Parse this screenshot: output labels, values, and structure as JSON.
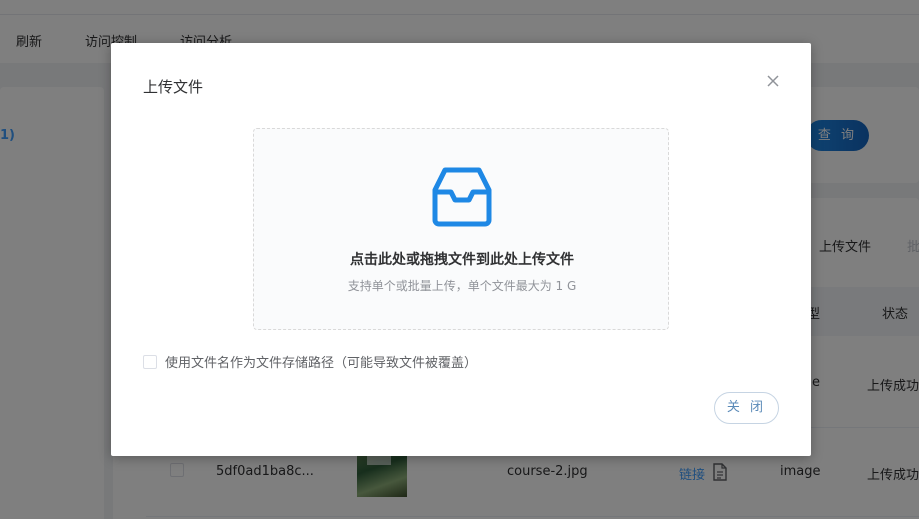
{
  "toolbar": {
    "refresh_label": "刷新",
    "access_control_label": "访问控制",
    "access_analysis_label": "访问分析"
  },
  "left_panel": {
    "partial_text": "1)"
  },
  "search": {
    "query_label": "查 询"
  },
  "content": {
    "upload_file_label": "上传文件",
    "more_label": "批",
    "columns": {
      "type_partial": "型",
      "status": "状态"
    },
    "rows": [
      {
        "type_partial": "e",
        "status": "上传成功"
      },
      {
        "id": "5df0ad1ba8c...",
        "filename": "course-2.jpg",
        "link_label": "链接",
        "type": "image",
        "status": "上传成功"
      }
    ]
  },
  "dialog": {
    "title": "上传文件",
    "dropzone_main": "点击此处或拖拽文件到此处上传文件",
    "dropzone_sub": "支持单个或批量上传，单个文件最大为 1 G",
    "option_label": "使用文件名作为文件存储路径（可能导致文件被覆盖）",
    "option_checked": false,
    "close_label": "关 闭"
  },
  "colors": {
    "accent": "#409eff",
    "upload_icon": "#1e88e5",
    "mask": "rgba(0,0,0,0.5)"
  },
  "icons": {
    "dropzone": "inbox-icon",
    "close": "close-icon",
    "link_doc": "document-icon"
  }
}
